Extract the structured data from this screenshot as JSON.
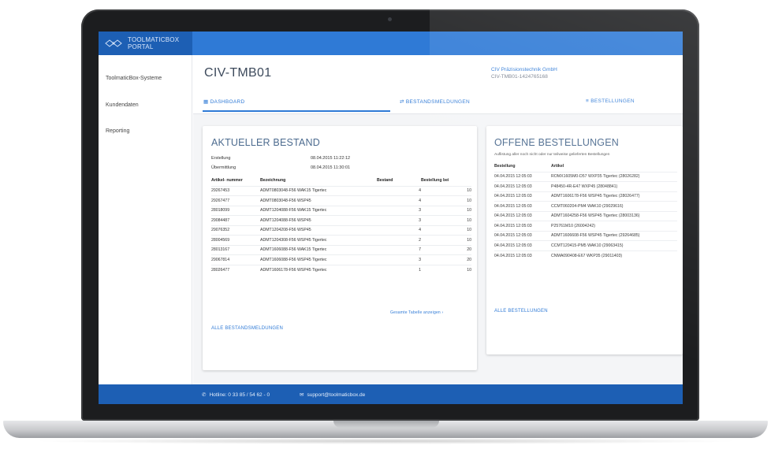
{
  "app": {
    "brand_line1": "TOOLMATICBOX",
    "brand_line2": "PORTAL",
    "accent_color": "#2f7ad6",
    "brand_color": "#1d5fb4"
  },
  "sidebar": {
    "items": [
      {
        "label": "ToolmaticBox-Systeme"
      },
      {
        "label": "Kundendaten"
      },
      {
        "label": "Reporting"
      }
    ]
  },
  "header": {
    "title": "CIV-TMB01",
    "company_name": "CIV Präzisionstechnik GmbH",
    "company_id": "CIV-TMB01-1424765168"
  },
  "tabs": [
    {
      "icon": "grid-icon",
      "label": "DASHBOARD"
    },
    {
      "icon": "arrows-icon",
      "label": "BESTANDSMELDUNGEN"
    },
    {
      "icon": "list-icon",
      "label": "BESTELLUNGEN"
    }
  ],
  "inventory": {
    "title": "AKTUELLER BESTAND",
    "meta": [
      {
        "label": "Erstellung",
        "value": "08.04.2015 11:22:12"
      },
      {
        "label": "Übermittlung",
        "value": "08.04.2015 11:30:01"
      }
    ],
    "columns": [
      "Artikel- nummer",
      "Bezeichnung",
      "Bestand",
      "Bestellung bei"
    ],
    "rows": [
      {
        "nr": "29267453",
        "bez": "ADMT0803048-F56 WAK15 Tigertec",
        "bestand": "4",
        "bei": "10"
      },
      {
        "nr": "29267477",
        "bez": "ADMT0803048-F56 WSP45",
        "bestand": "4",
        "bei": "10"
      },
      {
        "nr": "28018099",
        "bez": "ADMT1204088-F56 WAK15 Tigertec",
        "bestand": "3",
        "bei": "10"
      },
      {
        "nr": "29084487",
        "bez": "ADMT1204088-F56 WSP45",
        "bestand": "3",
        "bei": "10"
      },
      {
        "nr": "29076352",
        "bez": "ADMT1204208-F56 WSP45",
        "bestand": "4",
        "bei": "10"
      },
      {
        "nr": "28004569",
        "bez": "ADMT1204308-F56 WSP45 Tigertec",
        "bestand": "2",
        "bei": "10"
      },
      {
        "nr": "28013167",
        "bez": "ADMT1606088-F56 WAK15 Tigertec",
        "bestand": "7",
        "bei": "20"
      },
      {
        "nr": "29067814",
        "bez": "ADMT1606088-F56 WSP45 Tigertec",
        "bestand": "3",
        "bei": "20"
      },
      {
        "nr": "28026477",
        "bez": "ADMT1606178-F56 WSP45 Tigertec",
        "bestand": "1",
        "bei": "10"
      }
    ],
    "full_table_link": "Gesamte Tabelle anzeigen",
    "all_link": "ALLE BESTANDSMELDUNGEN"
  },
  "orders": {
    "title": "OFFENE BESTELLUNGEN",
    "subtitle": "Auflistung aller noch nicht oder nur teilweise gelieferten Bestellungen",
    "columns": [
      "Bestellung",
      "Artikel"
    ],
    "rows": [
      {
        "date": "04.04.2015 12:05:03",
        "art": "ROMX1605M0-D57 WXP35 Tigertec (28026282)"
      },
      {
        "date": "04.04.2015 12:05:03",
        "art": "P48450-4R-E47 WXP45 (28048841)"
      },
      {
        "date": "04.04.2015 12:05:03",
        "art": "ADMT1606178-F56 WSP45 Tigertec (28026477)"
      },
      {
        "date": "04.04.2015 12:05:03",
        "art": "CCMT060204-PM4 WAK10 (29029616)"
      },
      {
        "date": "04.04.2015 12:05:03",
        "art": "ADMT1604258-F56 WSP45 Tigertec (28003136)"
      },
      {
        "date": "04.04.2015 12:05:03",
        "art": "P25761M10 (26004242)"
      },
      {
        "date": "04.04.2015 12:05:03",
        "art": "ADMT1606608-F56 WSP45 Tigertec (29264685)"
      },
      {
        "date": "04.04.2015 12:05:03",
        "art": "CCMT120415-PM5 WAK10 (29063415)"
      },
      {
        "date": "04.04.2015 12:05:03",
        "art": "CNMA090408-E67 WKP35 (29011403)"
      }
    ],
    "all_link": "ALLE BESTELLUNGEN"
  },
  "footer": {
    "hotline": "Hotline: 0 33 85 / 54 62 - 0",
    "email": "support@toolmaticbox.de"
  }
}
